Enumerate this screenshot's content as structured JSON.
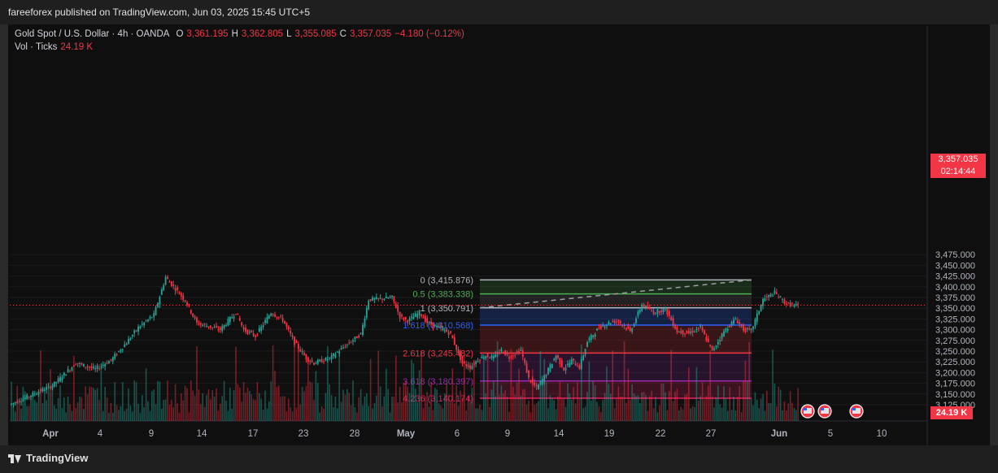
{
  "header": {
    "publisher_line": "fareeforex published on TradingView.com, Jun 03, 2025 15:45 UTC+5"
  },
  "footer": {
    "brand": "TradingView"
  },
  "legend": {
    "title": "Gold Spot / U.S. Dollar · 4h · OANDA",
    "open_label": "O",
    "open": "3,361.195",
    "high_label": "H",
    "high": "3,362.805",
    "low_label": "L",
    "low": "3,355.085",
    "close_label": "C",
    "close": "3,357.035",
    "change": "−4.180 (−0.12%)",
    "vol_title": "Vol · Ticks",
    "vol_value": "24.19 K"
  },
  "price_tag": {
    "price": "3,357.035",
    "countdown": "02:14:44"
  },
  "volume_tag": "24.19 K",
  "colors": {
    "up": "#26a69a",
    "down": "#f23645",
    "background": "#0f0f0f"
  },
  "icons": [
    "calendar-event-flag-icon",
    "calendar-event-flag-icon",
    "calendar-event-flag-icon"
  ],
  "chart_data": {
    "type": "candlestick",
    "ylim": [
      3110,
      3485
    ],
    "y_ticks": [
      "3,125.000",
      "3,150.000",
      "3,175.000",
      "3,200.000",
      "3,225.000",
      "3,250.000",
      "3,275.000",
      "3,300.000",
      "3,325.000",
      "3,350.000",
      "3,375.000",
      "3,400.000",
      "3,425.000",
      "3,450.000",
      "3,475.000"
    ],
    "x_ticks": [
      "Apr",
      "4",
      "9",
      "14",
      "17",
      "23",
      "28",
      "May",
      "6",
      "9",
      "14",
      "19",
      "22",
      "27",
      "Jun",
      "5",
      "10"
    ],
    "bold_x_ticks": [
      "Apr",
      "May",
      "Jun"
    ],
    "current_price": 3357.035,
    "path": [
      [
        0,
        3125
      ],
      [
        22,
        3170
      ],
      [
        34,
        3222
      ],
      [
        44,
        3208
      ],
      [
        52,
        3229
      ],
      [
        60,
        3270
      ],
      [
        66,
        3305
      ],
      [
        74,
        3334
      ],
      [
        80,
        3422
      ],
      [
        90,
        3368
      ],
      [
        96,
        3315
      ],
      [
        108,
        3300
      ],
      [
        116,
        3340
      ],
      [
        120,
        3300
      ],
      [
        126,
        3285
      ],
      [
        134,
        3340
      ],
      [
        140,
        3323
      ],
      [
        146,
        3270
      ],
      [
        152,
        3234
      ],
      [
        156,
        3222
      ],
      [
        164,
        3233
      ],
      [
        172,
        3262
      ],
      [
        180,
        3290
      ],
      [
        184,
        3370
      ],
      [
        190,
        3372
      ],
      [
        196,
        3375
      ],
      [
        200,
        3331
      ],
      [
        204,
        3320
      ],
      [
        210,
        3340
      ],
      [
        214,
        3316
      ],
      [
        220,
        3305
      ],
      [
        226,
        3290
      ],
      [
        232,
        3222
      ],
      [
        236,
        3212
      ],
      [
        240,
        3230
      ],
      [
        244,
        3240
      ],
      [
        248,
        3234
      ],
      [
        252,
        3252
      ],
      [
        256,
        3236
      ],
      [
        262,
        3252
      ],
      [
        266,
        3186
      ],
      [
        270,
        3164
      ],
      [
        274,
        3190
      ],
      [
        280,
        3240
      ],
      [
        284,
        3208
      ],
      [
        288,
        3228
      ],
      [
        292,
        3212
      ],
      [
        296,
        3272
      ],
      [
        302,
        3305
      ],
      [
        308,
        3318
      ],
      [
        312,
        3320
      ],
      [
        318,
        3296
      ],
      [
        324,
        3358
      ],
      [
        330,
        3340
      ],
      [
        336,
        3348
      ],
      [
        342,
        3296
      ],
      [
        348,
        3292
      ],
      [
        354,
        3305
      ],
      [
        360,
        3250
      ],
      [
        366,
        3296
      ],
      [
        372,
        3325
      ],
      [
        376,
        3300
      ],
      [
        380,
        3298
      ],
      [
        386,
        3370
      ],
      [
        392,
        3386
      ],
      [
        398,
        3360
      ],
      [
        404,
        3355
      ]
    ],
    "fibonacci": {
      "levels": [
        {
          "label": "0 (3,415.876)",
          "price": 3415.876,
          "color": "#b2b5be"
        },
        {
          "label": "0.5 (3,383.338)",
          "price": 3383.338,
          "color": "#4caf50"
        },
        {
          "label": "1 (3,350.791)",
          "price": 3350.791,
          "color": "#b2b5be"
        },
        {
          "label": "1.618 (3,310.568)",
          "price": 3310.568,
          "color": "#2962ff"
        },
        {
          "label": "2.618 (3,245.482)",
          "price": 3245.482,
          "color": "#f23645"
        },
        {
          "label": "3.618 (3,180.397)",
          "price": 3180.397,
          "color": "#9c27b0"
        },
        {
          "label": "4.236 (3,140.174)",
          "price": 3140.174,
          "color": "#e91e63"
        }
      ],
      "zone_fills": [
        "rgba(76,175,80,0.18)",
        "rgba(120,120,120,0.18)",
        "rgba(41,98,255,0.22)",
        "rgba(242,54,69,0.18)",
        "rgba(156,39,176,0.18)",
        "rgba(233,30,99,0.20)"
      ]
    }
  }
}
